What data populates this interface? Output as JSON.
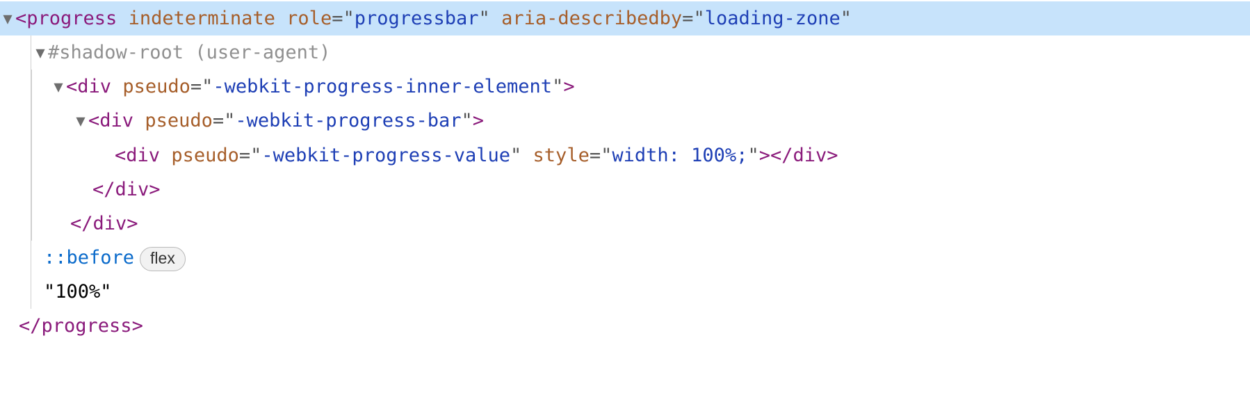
{
  "root": {
    "tag": "progress",
    "attrs": {
      "indeterminate": "indeterminate",
      "role_name": "role",
      "role_val": "progressbar",
      "aria_name": "aria-describedby",
      "aria_val": "loading-zone"
    },
    "close": "progress",
    "text": "\"100%\""
  },
  "shadow": {
    "label": "#shadow-root (user-agent)"
  },
  "inner": {
    "tag": "div",
    "pseudo_name": "pseudo",
    "pseudo_val": "-webkit-progress-inner-element",
    "close": "div"
  },
  "bar": {
    "tag": "div",
    "pseudo_name": "pseudo",
    "pseudo_val": "-webkit-progress-bar",
    "close": "div"
  },
  "value": {
    "tag": "div",
    "pseudo_name": "pseudo",
    "pseudo_val": "-webkit-progress-value",
    "style_name": "style",
    "style_val": "width: 100%;",
    "close": "div"
  },
  "pseudo_before": {
    "sel": "::before",
    "badge": "flex"
  }
}
